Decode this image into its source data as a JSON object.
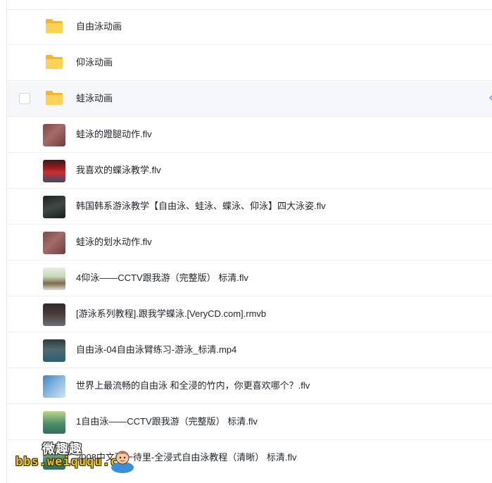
{
  "files": [
    {
      "name": "自由泳动画",
      "type": "folder"
    },
    {
      "name": "仰泳动画",
      "type": "folder"
    },
    {
      "name": "蛙泳动画",
      "type": "folder",
      "selected": true
    },
    {
      "name": "蛙泳的蹬腿动作.flv",
      "type": "video",
      "thumb": "th-skin"
    },
    {
      "name": "我喜欢的蝶泳教学.flv",
      "type": "video",
      "thumb": "th-red"
    },
    {
      "name": "韩国韩系游泳教学【自由泳、蛙泳、蝶泳、仰泳】四大泳姿.flv",
      "type": "video",
      "thumb": "th-dark"
    },
    {
      "name": "蛙泳的划水动作.flv",
      "type": "video",
      "thumb": "th-skin"
    },
    {
      "name": "4仰泳——CCTV跟我游（完整版） 标清.flv",
      "type": "video",
      "thumb": "th-cctv"
    },
    {
      "name": "[游泳系列教程].跟我学蝶泳.[VeryCD.com].rmvb",
      "type": "video",
      "thumb": "th-pool"
    },
    {
      "name": "自由泳-04自由泳臂练习-游泳_标清.mp4",
      "type": "video",
      "thumb": "th-swim"
    },
    {
      "name": "世界上最流畅的自由泳 和全浸的竹内，你更喜欢哪个？.flv",
      "type": "video",
      "thumb": "th-blue"
    },
    {
      "name": "1自由泳——CCTV跟我游（完整版） 标清.flv",
      "type": "video",
      "thumb": "th-green"
    },
    {
      "name": "2008中文西一待里-全浸式自由泳教程（清晰） 标清.flv",
      "type": "video",
      "thumb": "th-green"
    }
  ],
  "watermark": {
    "cn": "微趣趣",
    "url": "bbs.weiququ.cn"
  },
  "colors": {
    "folder": "#f7c948",
    "selected_bg": "#f5f7fa",
    "accent": "#4a9eff"
  }
}
